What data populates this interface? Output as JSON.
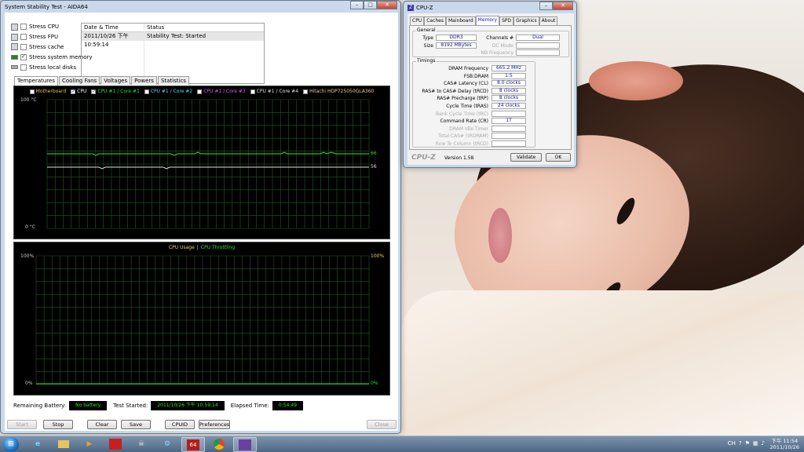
{
  "aida": {
    "title": "System Stability Test - AIDA64",
    "stress_items": [
      {
        "label": "Stress CPU",
        "checked": false
      },
      {
        "label": "Stress FPU",
        "checked": false
      },
      {
        "label": "Stress cache",
        "checked": false
      },
      {
        "label": "Stress system memory",
        "checked": true
      },
      {
        "label": "Stress local disks",
        "checked": false
      }
    ],
    "status_table": {
      "headers": [
        "Date & Time",
        "Status"
      ],
      "rows": [
        [
          "2011/10/26 下午 10:59:14",
          "Stability Test: Started"
        ]
      ]
    },
    "tabs": [
      "Temperatures",
      "Cooling Fans",
      "Voltages",
      "Powers",
      "Statistics"
    ],
    "temp_graph": {
      "legend": [
        {
          "label": "Motherboard",
          "checked": false,
          "color": "#d6c35c"
        },
        {
          "label": "CPU",
          "checked": true,
          "color": "#ffffff"
        },
        {
          "label": "CPU #1 / Core #1",
          "checked": true,
          "color": "#31e231"
        },
        {
          "label": "CPU #1 / Core #2",
          "checked": false,
          "color": "#5dd9f5"
        },
        {
          "label": "CPU #1 / Core #3",
          "checked": false,
          "color": "#e05ce0"
        },
        {
          "label": "CPU #1 / Core #4",
          "checked": false,
          "color": "#e0e0e0"
        },
        {
          "label": "Hitachi HDP725050GLA360",
          "checked": false,
          "color": "#e6d58a"
        }
      ],
      "y_top": "100 °C",
      "y_bottom": "0 °C",
      "value_a": "66",
      "value_b": "56"
    },
    "usage_graph": {
      "legend_a": "CPU Usage",
      "legend_sep": "|",
      "legend_b": "CPU Throttling",
      "y_top": "100%",
      "y_bottom": "0%",
      "y_top_right": "100%",
      "y_bottom_right": "0%"
    },
    "remaining_battery_label": "Remaining Battery:",
    "remaining_battery": "No battery",
    "test_started_label": "Test Started:",
    "test_started": "2011/10/26 下午 10:59:14",
    "elapsed_label": "Elapsed Time:",
    "elapsed": "0:54:49",
    "buttons": {
      "start": "Start",
      "stop": "Stop",
      "clear": "Clear",
      "save": "Save",
      "cpuid": "CPUID",
      "preferences": "Preferences",
      "close": "Close"
    }
  },
  "cpuz": {
    "title": "CPU-Z",
    "tabs": [
      "CPU",
      "Caches",
      "Mainboard",
      "Memory",
      "SPD",
      "Graphics",
      "About"
    ],
    "general": {
      "label": "General",
      "type_label": "Type",
      "type": "DDR3",
      "size_label": "Size",
      "size": "8192 MBytes",
      "channels_label": "Channels #",
      "channels": "Dual",
      "dc_mode_label": "DC Mode",
      "nb_freq_label": "NB Frequency"
    },
    "timings": {
      "label": "Timings",
      "rows": [
        {
          "label": "DRAM Frequency",
          "value": "665.2 MHz",
          "grey": false
        },
        {
          "label": "FSB:DRAM",
          "value": "1:5",
          "grey": false
        },
        {
          "label": "CAS# Latency (CL)",
          "value": "8.0 clocks",
          "grey": false
        },
        {
          "label": "RAS# to CAS# Delay (tRCD)",
          "value": "8 clocks",
          "grey": false
        },
        {
          "label": "RAS# Precharge (tRP)",
          "value": "8 clocks",
          "grey": false
        },
        {
          "label": "Cycle Time (tRAS)",
          "value": "24 clocks",
          "grey": false
        },
        {
          "label": "Bank Cycle Time (tRC)",
          "value": "",
          "grey": true
        },
        {
          "label": "Command Rate (CR)",
          "value": "1T",
          "grey": false
        },
        {
          "label": "DRAM Idle Timer",
          "value": "",
          "grey": true
        },
        {
          "label": "Total CAS# (tRDRAM)",
          "value": "",
          "grey": true
        },
        {
          "label": "Row To Column (tRCD)",
          "value": "",
          "grey": true
        }
      ]
    },
    "brand": "CPU-Z",
    "version": "Version 1.58",
    "validate": "Validate",
    "ok": "OK"
  },
  "taskbar": {
    "tray_lang": "CH",
    "clock_time": "下午 11:54",
    "clock_date": "2011/10/26"
  }
}
